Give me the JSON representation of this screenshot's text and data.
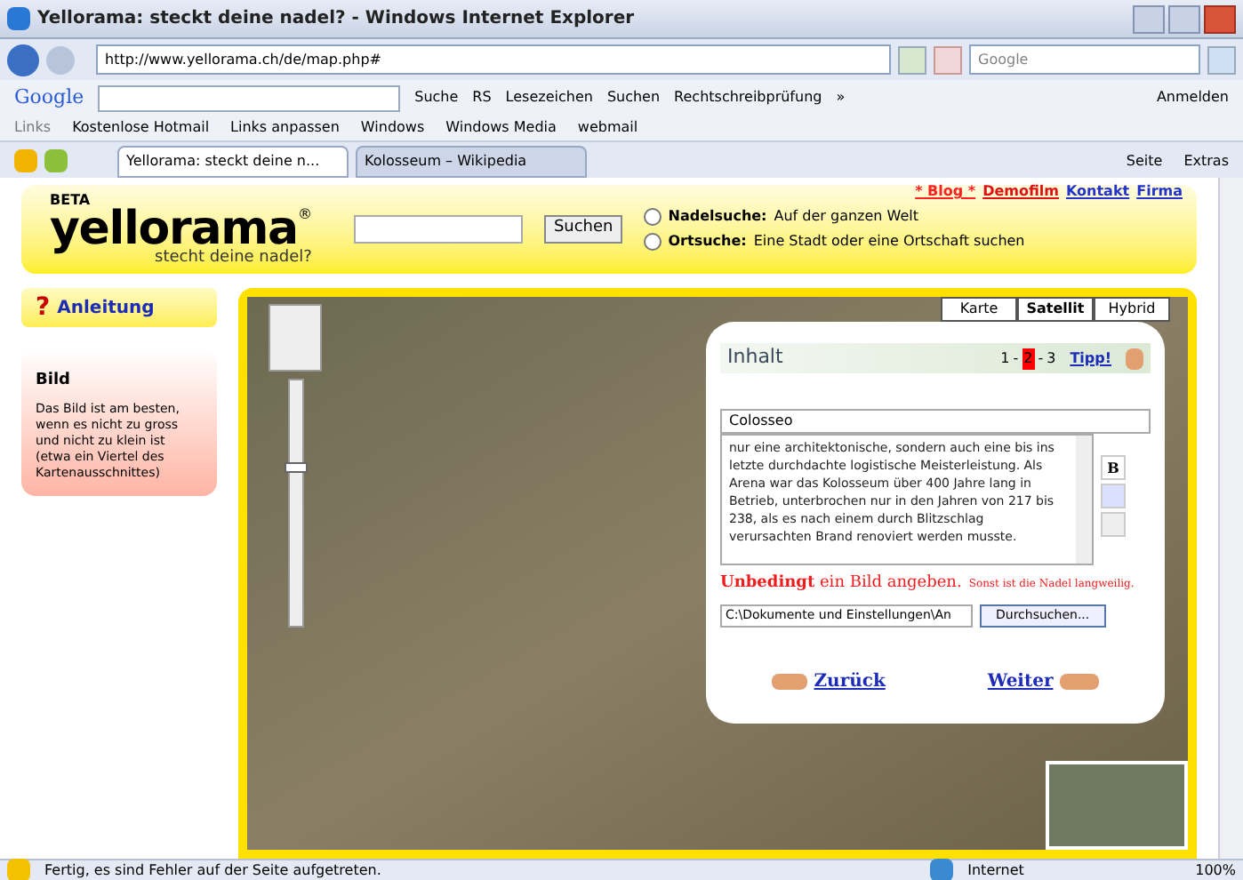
{
  "window": {
    "title": "Yellorama: steckt deine nadel? - Windows Internet Explorer"
  },
  "address_bar": {
    "url": "http://www.yellorama.ch/de/map.php#",
    "search_placeholder": "Google"
  },
  "google_toolbar": {
    "logo": "Google",
    "items": [
      "Suche",
      "RS",
      "Lesezeichen",
      "Suchen",
      "Rechtschreibprüfung",
      "»",
      "Anmelden"
    ]
  },
  "links_bar": {
    "label": "Links",
    "items": [
      "Kostenlose Hotmail",
      "Links anpassen",
      "Windows",
      "Windows Media",
      "webmail"
    ]
  },
  "tabs": [
    {
      "label": "Yellorama: steckt deine n...",
      "selected": true
    },
    {
      "label": "Kolosseum – Wikipedia",
      "selected": false
    }
  ],
  "command_bar": [
    "Seite",
    "Extras"
  ],
  "site": {
    "beta": "BETA",
    "logo": "yellorama",
    "registered": "®",
    "slogan": "stecht deine nadel?",
    "search_button": "Suchen",
    "top_links": [
      {
        "label": "* Blog *",
        "color": "#ff2020"
      },
      {
        "label": "Demofilm",
        "color": "#dd1111"
      },
      {
        "label": "Kontakt",
        "color": "#2233cc"
      },
      {
        "label": "Firma",
        "color": "#2233cc"
      }
    ],
    "search_modes": [
      {
        "title": "Nadelsuche:",
        "text": "Auf der ganzen Welt",
        "selected": false
      },
      {
        "title": "Ortsuche:",
        "text": "Eine Stadt oder eine Ortschaft suchen",
        "selected": false
      }
    ]
  },
  "map_zoom": {
    "level": 0.65
  },
  "sidebar": {
    "help_mark": "?",
    "help": "Anleitung",
    "card_title": "Bild",
    "card_text": "Das Bild ist am besten, wenn es nicht zu gross und nicht zu klein ist (etwa ein Viertel des Kartenausschnittes)"
  },
  "map_types": [
    {
      "label": "Karte",
      "selected": false
    },
    {
      "label": "Satellit",
      "selected": true
    },
    {
      "label": "Hybrid",
      "selected": false
    }
  ],
  "popup": {
    "title": "Inhalt",
    "step_separator": "-",
    "steps": [
      {
        "label": "1",
        "selected": false
      },
      {
        "label": "2",
        "selected": true
      },
      {
        "label": "3",
        "selected": false
      }
    ],
    "tip": "Tipp!",
    "name_value": "Colosseo",
    "description": "nur eine architektonische, sondern auch eine bis ins letzte durchdachte logistische Meisterleistung. Als Arena war das Kolosseum über 400 Jahre lang in Betrieb, unterbrochen nur in den Jahren von 217 bis 238, als es nach einem durch Blitzschlag verursachten Brand renoviert werden musste.",
    "format_buttons": [
      "B"
    ],
    "warning": "**Unbedingt** ein Bild angeben.",
    "warning_note": "Sonst ist die Nadel langweilig.",
    "file_value": "C:\\Dokumente und Einstellungen\\An",
    "browse": "Durchsuchen...",
    "back": "Zurück",
    "next": "Weiter"
  },
  "status_bar": {
    "text": "Fertig, es sind Fehler auf der Seite aufgetreten.",
    "zone": "Internet",
    "zoom": "100%"
  }
}
